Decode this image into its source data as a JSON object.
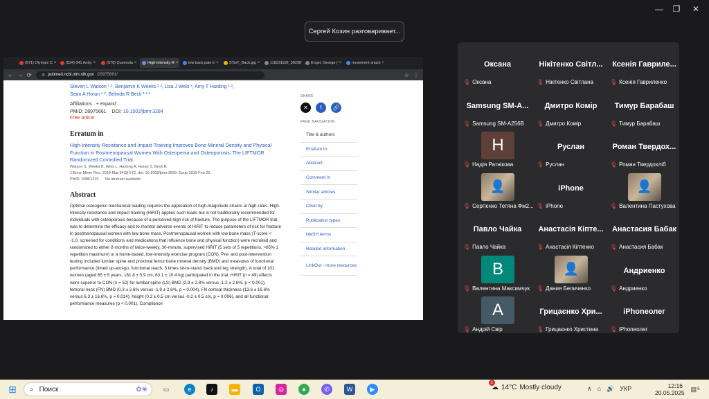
{
  "toast": "Сергей Козин разговаривает...",
  "browser": {
    "tabs": [
      {
        "title": "(571) Olympic C",
        "color": "#e53935"
      },
      {
        "title": "(534) 041 Andy",
        "color": "#e53935"
      },
      {
        "title": "(579) Queensla",
        "color": "#e53935"
      },
      {
        "title": "High-intensity R",
        "color": "#6a8fd6"
      },
      {
        "title": "low back pain tr",
        "color": "#4285f4"
      },
      {
        "title": "STarT_Back.jpg",
        "color": "#f4b400"
      },
      {
        "title": "118231192_3929874",
        "color": "#888"
      },
      {
        "title": "Engel, George (",
        "color": "#888"
      },
      {
        "title": "movement snack",
        "color": "#4285f4"
      }
    ],
    "url_host": "pubmed.ncbi.nlm.nih.gov",
    "url_path": "/28975661/",
    "authors_line1": "Steven L Watson ¹ ², Benjamin K Weeks ¹ ², Lisa J Weis ³, Amy T Harding ¹ ²,",
    "authors_line2": "Sean A Horan ¹ ², Belinda R Beck ¹ ² ³",
    "affiliations": "Affiliations",
    "expand": "+ expand",
    "pmid": "PMID: 28975661",
    "doi_label": "DOI:",
    "doi": "10.1002/jbmr.3284",
    "free": "Free article",
    "erratum_heading": "Erratum in",
    "erratum_title": "High-Intensity Resistance and Impact Training Improves Bone Mineral Density and Physical Function in Postmenopausal Women With Osteopenia and Osteoporosis: The LIFTMOR Randomized Controlled Trial.",
    "erratum_authors": "Watson S, Weeks B, Weis L, Harding A, Horan S, Beck B.",
    "erratum_journal": "J Bone Miner Res. 2019 Mar;34(3):572. doi: 10.1002/jbmr.3659. Epub 2019 Feb 25.",
    "erratum_pmid": "PMID: 30861219",
    "erratum_noabs": "No abstract available.",
    "abstract_heading": "Abstract",
    "abstract_text": "Optimal osteogenic mechanical loading requires the application of high-magnitude strains at high rates. High-intensity resistance and impact training (HiRIT) applies such loads but is not traditionally recommended for individuals with osteoporosis because of a perceived high risk of fracture. The purpose of the LIFTMOR trial was to determine the efficacy and to monitor adverse events of HiRIT to reduce parameters of risk for fracture in postmenopausal women with low bone mass. Postmenopausal women with low bone mass (T-score < -1.0, screened for conditions and medications that influence bone and physical function) were recruited and randomized to either 8 months of twice-weekly, 30-minute, supervised HiRIT (5 sets of 5 repetitions, >85% 1 repetition maximum) or a home-based, low-intensity exercise program (CON). Pre- and post-intervention testing included lumbar spine and proximal femur bone mineral density (BMD) and measures of functional performance (timed up-and-go, functional reach, 5 times sit-to-stand, back and leg strength). A total of 101 women (aged 65 ± 5 years, 161.8 ± 5.9 cm, 63.1 ± 10.4 kg) participated in the trial. HiRIT (n = 49) effects were superior to CON (n = 52) for lumbar spine (LS) BMD (2.9 ± 2.8% versus -1.2 ± 2.8%, p < 0.001), femoral neck (FN) BMD (0.3 ± 2.6% versus -1.9 ± 2.6%, p = 0.004), FN cortical thickness (13.6 ± 16.6% versus 6.3 ± 16.6%, p = 0.014), height (0.2 ± 0.5 cm versus -0.2 ± 0.5 cm, p = 0.006), and all functional performance measures (p < 0.001). Compliance",
    "share_label": "SHARE",
    "pagenav_label": "PAGE NAVIGATION",
    "nav": [
      "Title & authors",
      "Erratum in",
      "Abstract",
      "Comment in",
      "Similar articles",
      "Cited by",
      "Publication types",
      "MeSH terms",
      "Related information",
      "LinkOut - more resources"
    ]
  },
  "participants": [
    {
      "big": "Оксана",
      "label": "Оксана"
    },
    {
      "big": "Нікітенко Світл...",
      "label": "Нікітенко Світлана"
    },
    {
      "big": "Ксенія Гавриле...",
      "label": "Ксенія Гавриленко"
    },
    {
      "big": "Samsung SM-A...",
      "label": "Samsung SM-A256B"
    },
    {
      "big": "Дмитро Комір",
      "label": "Дмитро Комір"
    },
    {
      "big": "Тимур Барабаш",
      "label": "Тимур Барабаш"
    },
    {
      "avatar": "Н",
      "avatar_color": "#5d4037",
      "label": "Надія Ратнікова"
    },
    {
      "big": "Руслан",
      "label": "Руслан"
    },
    {
      "big": "Роман Твердох...",
      "label": "Роман Твердохліб"
    },
    {
      "photo": true,
      "label": "Сергієнко Тетяна Фм2..."
    },
    {
      "big": "iPhone",
      "label": "iPhone"
    },
    {
      "photo": true,
      "label": "Валентина Пастухова"
    },
    {
      "big": "Павло Чайка",
      "label": "Павло Чайка"
    },
    {
      "big": "Анастасія Кіпте...",
      "label": "Анастасія Кіптенко"
    },
    {
      "big": "Анастасия Бабак",
      "label": "Анастасия Бабак"
    },
    {
      "avatar": "В",
      "avatar_color": "#00897b",
      "label": "Валентина Максимчук"
    },
    {
      "photo": true,
      "label": "Дания Беличенко"
    },
    {
      "big": "Андриенко",
      "label": "Андриенко"
    },
    {
      "avatar": "А",
      "avatar_color": "#455a64",
      "label": "Андрій Свір"
    },
    {
      "big": "Грицаєнко Хри...",
      "label": "Грицаєнко Христина"
    },
    {
      "big": "iPhoneолег",
      "label": "iPhoneолег"
    }
  ],
  "taskbar": {
    "search": "Поиск",
    "weather_temp": "14°C",
    "weather_text": "Mostly cloudy",
    "lang": "УКР",
    "time": "12:16",
    "date": "20.05.2025",
    "notif_count": "1",
    "tray_badge": "5"
  }
}
